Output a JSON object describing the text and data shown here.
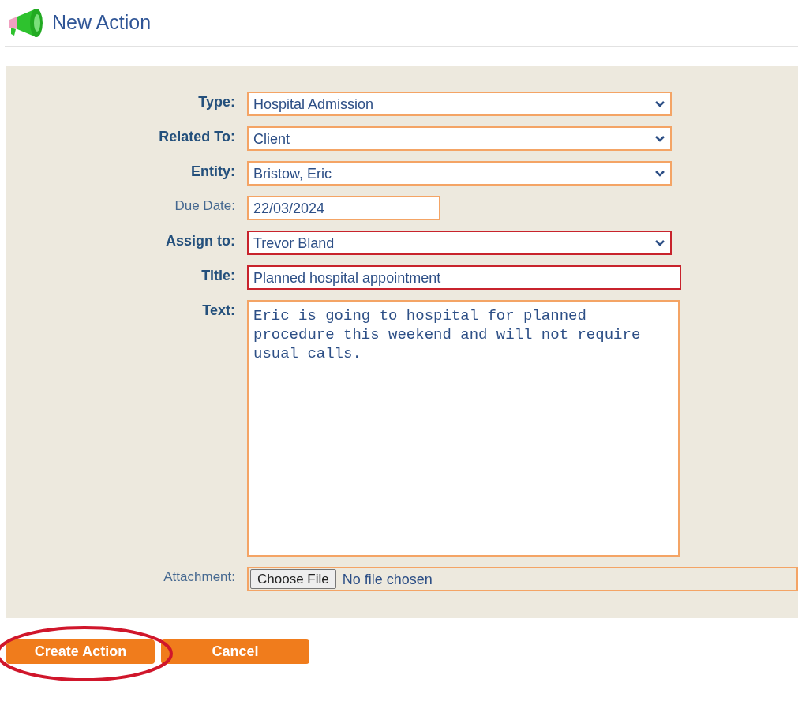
{
  "header": {
    "title": "New Action"
  },
  "fields": [
    {
      "label": "Type:",
      "bold": true,
      "kind": "select",
      "value": "Hospital Admission",
      "invalid": false
    },
    {
      "label": "Related To:",
      "bold": true,
      "kind": "select",
      "value": "Client",
      "invalid": false
    },
    {
      "label": "Entity:",
      "bold": true,
      "kind": "select",
      "value": "Bristow, Eric",
      "invalid": false
    },
    {
      "label": "Due Date:",
      "bold": false,
      "kind": "date",
      "value": "22/03/2024",
      "invalid": false
    },
    {
      "label": "Assign to:",
      "bold": true,
      "kind": "select",
      "value": "Trevor Bland",
      "invalid": true
    },
    {
      "label": "Title:",
      "bold": true,
      "kind": "text",
      "value": "Planned hospital appointment",
      "invalid": true
    },
    {
      "label": "Text:",
      "bold": true,
      "kind": "textarea",
      "value": "Eric is going to hospital for planned procedure this weekend and will not require usual calls.",
      "invalid": false
    },
    {
      "label": "Attachment:",
      "bold": false,
      "kind": "file",
      "button": "Choose File",
      "value": "No file chosen",
      "invalid": false
    }
  ],
  "buttons": [
    {
      "label": "Create Action",
      "circled": true
    },
    {
      "label": "Cancel",
      "circled": false
    }
  ]
}
